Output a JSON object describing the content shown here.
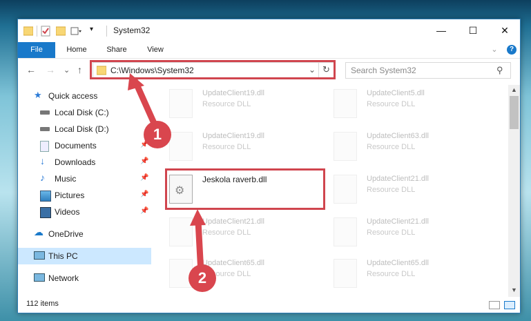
{
  "window": {
    "title": "System32",
    "controls": {
      "minimize": "—",
      "maximize": "☐",
      "close": "✕"
    }
  },
  "ribbon": {
    "tabs": [
      "File",
      "Home",
      "Share",
      "View"
    ],
    "expand_glyph": "⌄",
    "help_glyph": "?"
  },
  "nav": {
    "back": "←",
    "forward": "→",
    "recent": "⌄",
    "up": "↑",
    "address": "C:\\Windows\\System32",
    "dropdown": "⌄",
    "refresh": "↻",
    "search_placeholder": "Search System32",
    "search_glyph": "⚲"
  },
  "sidebar": {
    "items": [
      {
        "label": "Quick access",
        "icon": "star-icon"
      },
      {
        "label": "Local Disk (C:)",
        "icon": "drive-icon"
      },
      {
        "label": "Local Disk (D:)",
        "icon": "drive-icon"
      },
      {
        "label": "Documents",
        "icon": "documents-icon",
        "pinned": true
      },
      {
        "label": "Downloads",
        "icon": "downloads-icon",
        "pinned": true
      },
      {
        "label": "Music",
        "icon": "music-icon",
        "pinned": true
      },
      {
        "label": "Pictures",
        "icon": "pictures-icon",
        "pinned": true
      },
      {
        "label": "Videos",
        "icon": "videos-icon",
        "pinned": true
      },
      {
        "label": "OneDrive",
        "icon": "cloud-icon"
      },
      {
        "label": "This PC",
        "icon": "computer-icon"
      },
      {
        "label": "Network",
        "icon": "network-icon"
      }
    ],
    "pin_glyph": "📌"
  },
  "files": [
    {
      "name": "UpdateClient19.dll",
      "type": "Resource DLL"
    },
    {
      "name": "UpdateClient5.dll",
      "type": "Resource DLL"
    },
    {
      "name": "UpdateClient19.dll",
      "type": "Resource DLL"
    },
    {
      "name": "UpdateClient63.dll",
      "type": "Resource DLL"
    },
    {
      "name": "Jeskola raverb.dll",
      "type": ""
    },
    {
      "name": "UpdateClient21.dll",
      "type": "Resource DLL"
    },
    {
      "name": "UpdateClient21.dll",
      "type": "Resource DLL"
    },
    {
      "name": "UpdateClient21.dll",
      "type": "Resource DLL"
    },
    {
      "name": "UpdateClient65.dll",
      "type": "Resource DLL"
    },
    {
      "name": "UpdateClient65.dll",
      "type": "Resource DLL"
    }
  ],
  "status": {
    "item_count": "112 items"
  },
  "annotations": {
    "step1": "1",
    "step2": "2",
    "color": "#d9464e"
  },
  "colors": {
    "accent": "#1979ca",
    "selection": "#cce8ff"
  }
}
